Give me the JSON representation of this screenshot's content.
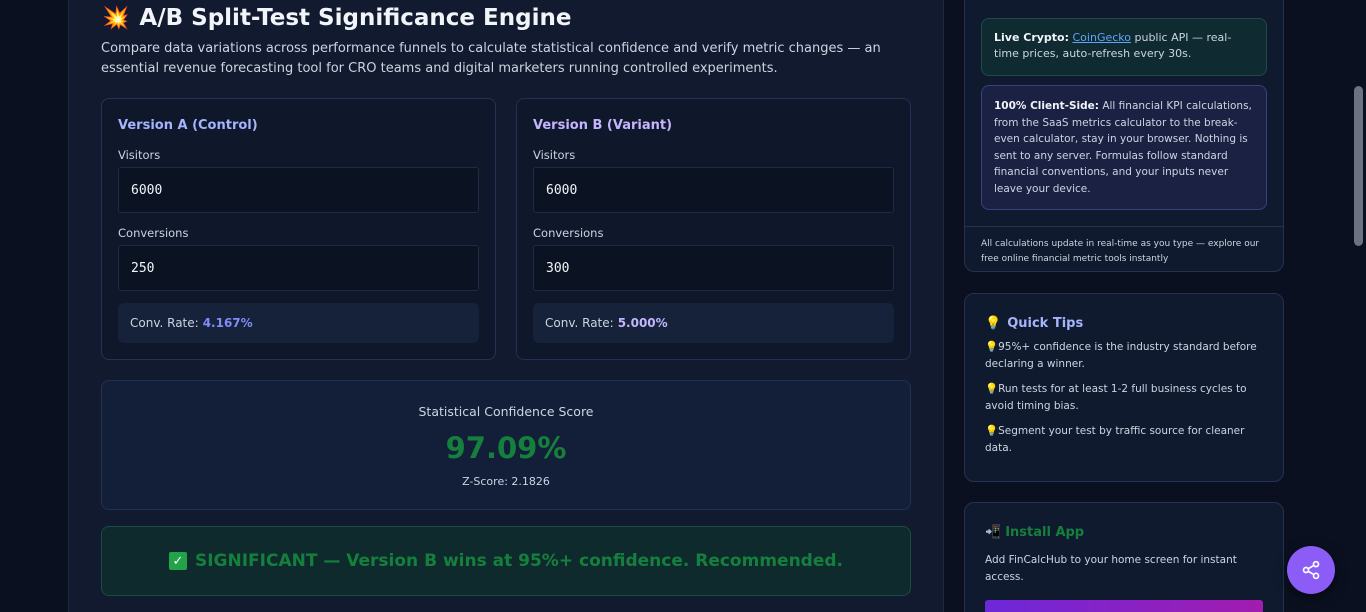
{
  "header": {
    "title": "A/B Split-Test Significance Engine",
    "icon": "collision-icon",
    "description": "Compare data variations across performance funnels to calculate statistical confidence and verify metric changes — an essential revenue forecasting tool for CRO teams and digital marketers running controlled experiments."
  },
  "version_a": {
    "title": "Version A (Control)",
    "visitors_label": "Visitors",
    "visitors": "6000",
    "conversions_label": "Conversions",
    "conversions": "250",
    "rate_label": "Conv. Rate:",
    "rate": "4.167%"
  },
  "version_b": {
    "title": "Version B (Variant)",
    "visitors_label": "Visitors",
    "visitors": "6000",
    "conversions_label": "Conversions",
    "conversions": "300",
    "rate_label": "Conv. Rate:",
    "rate": "5.000%"
  },
  "confidence": {
    "label": "Statistical Confidence Score",
    "value": "97.09%",
    "zscore": "Z-Score: 2.1826"
  },
  "verdict": {
    "text": "SIGNIFICANT — Version B wins at 95%+ confidence. Recommended."
  },
  "sidebar": {
    "crypto_bold": "Live Crypto:",
    "crypto_link": "CoinGecko",
    "crypto_rest": "public API — real-time prices, auto-refresh every 30s.",
    "client_bold": "100% Client-Side:",
    "client_rest": "All financial KPI calculations, from the SaaS metrics calculator to the break-even calculator, stay in your browser. Nothing is sent to any server. Formulas follow standard financial conventions, and your inputs never leave your device.",
    "footer": "All calculations update in real-time as you type — explore our free online financial metric tools instantly"
  },
  "tips": {
    "title": "Quick Tips",
    "items": [
      "95%+ confidence is the industry standard before declaring a winner.",
      "Run tests for at least 1-2 full business cycles to avoid timing bias.",
      "Segment your test by traffic source for cleaner data."
    ]
  },
  "install": {
    "title": "Install App",
    "text": "Add FinCalcHub to your home screen for instant access."
  },
  "colors": {
    "accent": "#8b5cf6",
    "success": "#15803d"
  }
}
